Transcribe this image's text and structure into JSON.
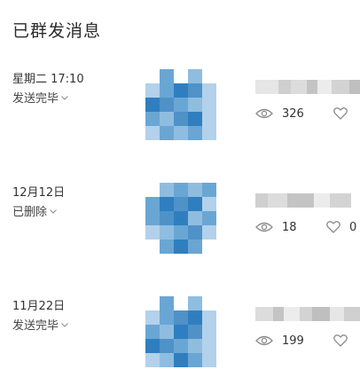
{
  "page": {
    "title": "已群发消息"
  },
  "messages": [
    {
      "date": "星期二 17:10",
      "status": "发送完毕",
      "views": "326",
      "likes": ""
    },
    {
      "date": "12月12日",
      "status": "已删除",
      "views": "18",
      "likes": "0"
    },
    {
      "date": "11月22日",
      "status": "发送完毕",
      "views": "199",
      "likes": ""
    }
  ],
  "icons": {
    "views": "eye-icon",
    "likes": "heart-icon",
    "status_toggle": "chevron-down-icon"
  },
  "colors": {
    "thumb_dark": "#2f7fc0",
    "thumb_mid": "#6aa6d4",
    "thumb_light": "#b3d1ea",
    "icon": "#8a8a8a"
  }
}
